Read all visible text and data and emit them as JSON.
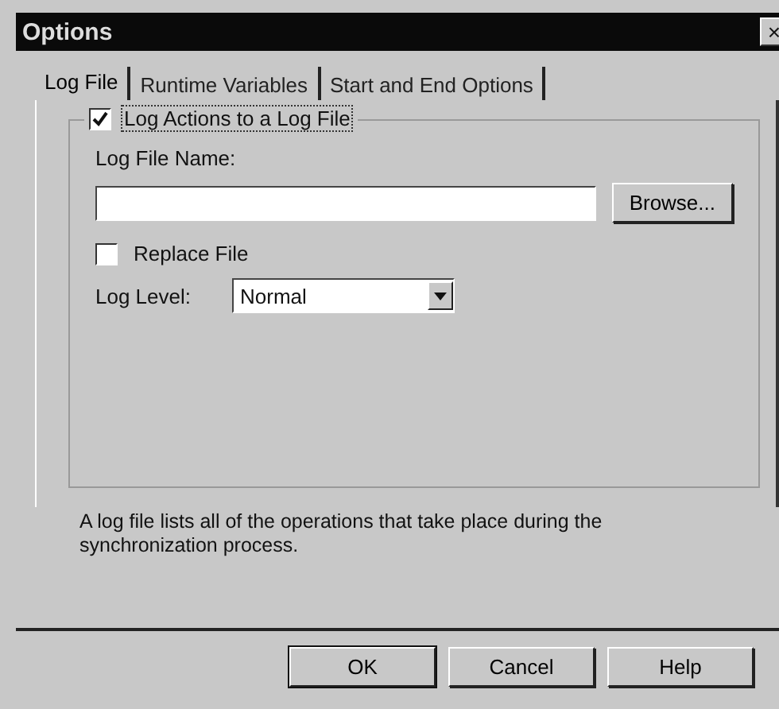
{
  "window": {
    "title": "Options",
    "close": "×"
  },
  "tabs": [
    {
      "label": "Log File",
      "selected": true
    },
    {
      "label": "Runtime Variables",
      "selected": false
    },
    {
      "label": "Start and End Options",
      "selected": false
    }
  ],
  "log_group": {
    "label": "Log Actions to a Log File",
    "checked": true
  },
  "log_file_name": {
    "label": "Log File Name:",
    "browse": "Browse..."
  },
  "replace_file": {
    "label": "Replace File",
    "checked": false
  },
  "log_level": {
    "label": "Log Level:",
    "value": "Normal"
  },
  "description": "A log file lists all of the operations that take place during the synchronization process.",
  "buttons": [
    {
      "label": "OK",
      "default": true
    },
    {
      "label": "Cancel",
      "default": false
    },
    {
      "label": "Help",
      "default": false
    }
  ]
}
